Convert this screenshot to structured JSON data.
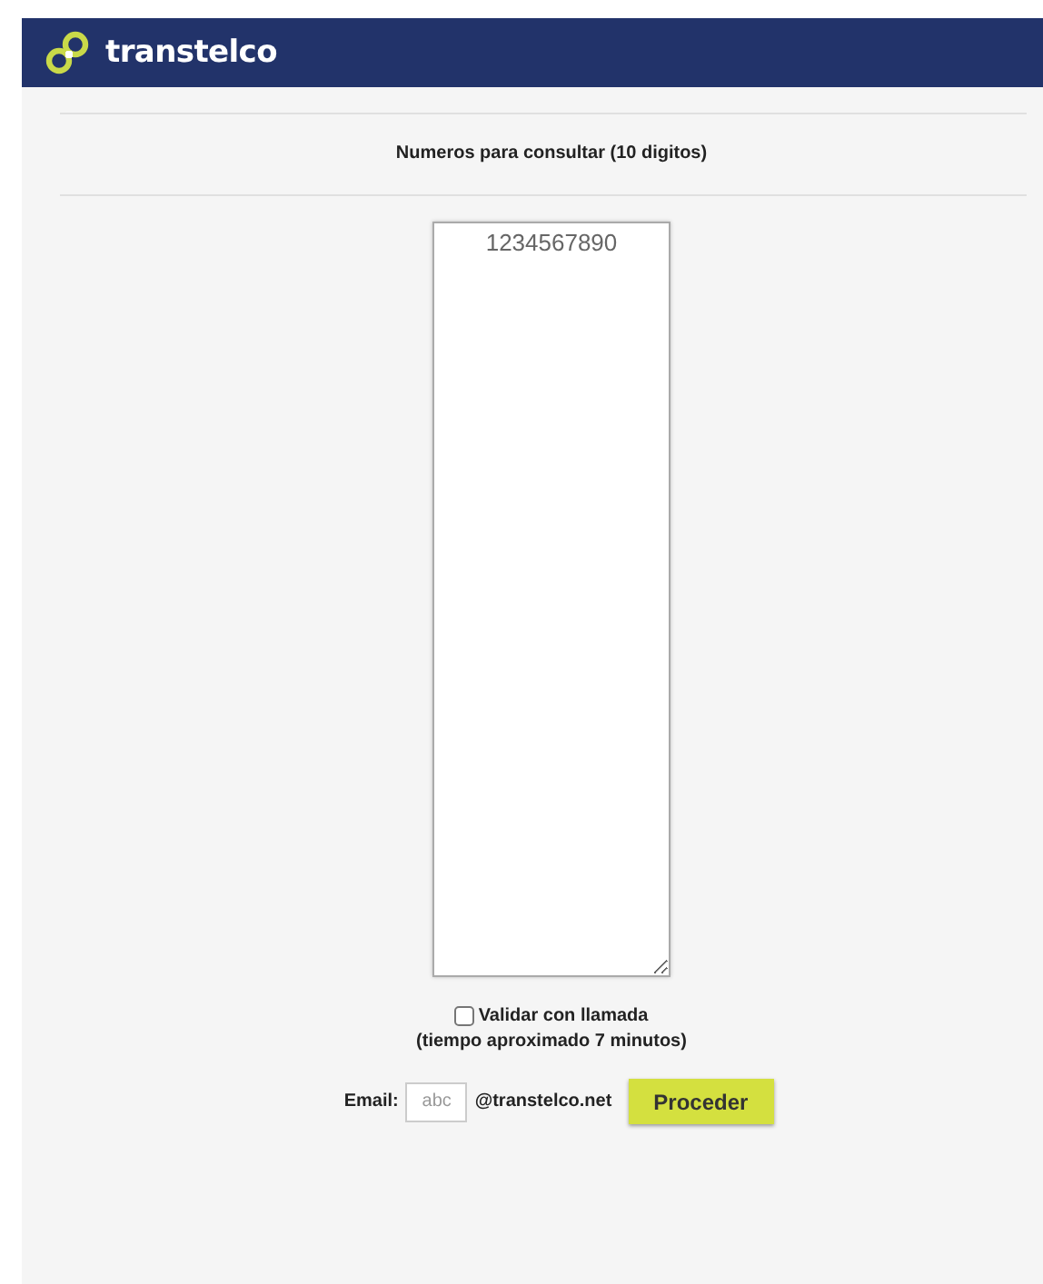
{
  "header": {
    "brand": "transtelco"
  },
  "form": {
    "heading": "Numeros para consultar (10 digitos)",
    "numbers": {
      "value": "1234567890"
    },
    "validate_call": {
      "label": "Validar con llamada",
      "checked": false,
      "note": "(tiempo aproximado 7 minutos)"
    },
    "email": {
      "label": "Email:",
      "placeholder": "abc",
      "domain": "@transtelco.net"
    },
    "submit": "Proceder"
  }
}
